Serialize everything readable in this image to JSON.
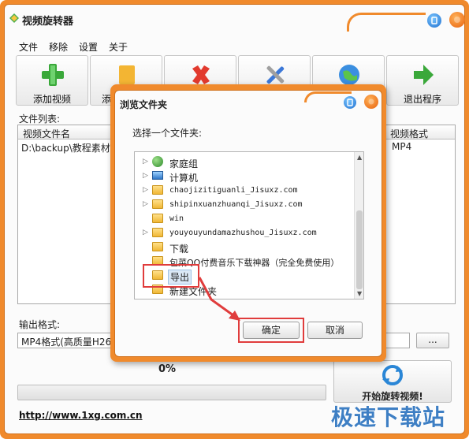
{
  "app": {
    "title": "视频旋转器",
    "icons": {
      "app": "app-logo-icon",
      "minimize": "minimize-icon",
      "close": "close-icon"
    }
  },
  "menu": [
    "文件",
    "移除",
    "设置",
    "关于"
  ],
  "toolbar": {
    "add_video": "添加视频",
    "add_folder": "添",
    "exit": "退出程序",
    "icons": [
      "plus-icon",
      "folder-icon",
      "delete-icon",
      "tools-icon",
      "globe-icon",
      "exit-arrow-icon"
    ]
  },
  "file_list": {
    "label": "文件列表:",
    "columns": {
      "name": "视频文件名",
      "format": "视频格式"
    },
    "rows": [
      {
        "name": "D:\\backup\\教程素材\\",
        "format": "MP4"
      }
    ]
  },
  "output": {
    "label": "输出格式:",
    "value": "MP4格式(高质量H264",
    "browse": "..."
  },
  "progress": {
    "text": "0%",
    "value": 0
  },
  "start_button": "开始旋转视频!",
  "footer_link": "http://www.1xg.com.cn",
  "watermark": "极速下载站",
  "dialog": {
    "title": "浏览文件夹",
    "prompt": "选择一个文件夹:",
    "ok": "确定",
    "cancel": "取消",
    "tree": [
      {
        "label": "家庭组",
        "icon": "homegroup-icon",
        "expandable": true
      },
      {
        "label": "计算机",
        "icon": "computer-icon",
        "expandable": true
      },
      {
        "label": "chaojizitiguanli_Jisuxz.com",
        "icon": "folder-icon",
        "expandable": true
      },
      {
        "label": "shipinxuanzhuanqi_Jisuxz.com",
        "icon": "folder-icon",
        "expandable": true
      },
      {
        "label": "win",
        "icon": "folder-icon",
        "expandable": false
      },
      {
        "label": "youyouyundamazhushou_Jisuxz.com",
        "icon": "folder-icon",
        "expandable": true
      },
      {
        "label": "下载",
        "icon": "folder-icon",
        "expandable": false
      },
      {
        "label": "包菜QQ付费音乐下载神器（完全免费使用）",
        "icon": "folder-icon",
        "expandable": false
      },
      {
        "label": "导出",
        "icon": "folder-icon",
        "expandable": false,
        "selected": true
      },
      {
        "label": "新建文件夹",
        "icon": "folder-icon",
        "expandable": false
      }
    ]
  },
  "colors": {
    "frame": "#f08a2c",
    "highlight": "#e03c3c",
    "accent_blue": "#1e6fd0"
  }
}
